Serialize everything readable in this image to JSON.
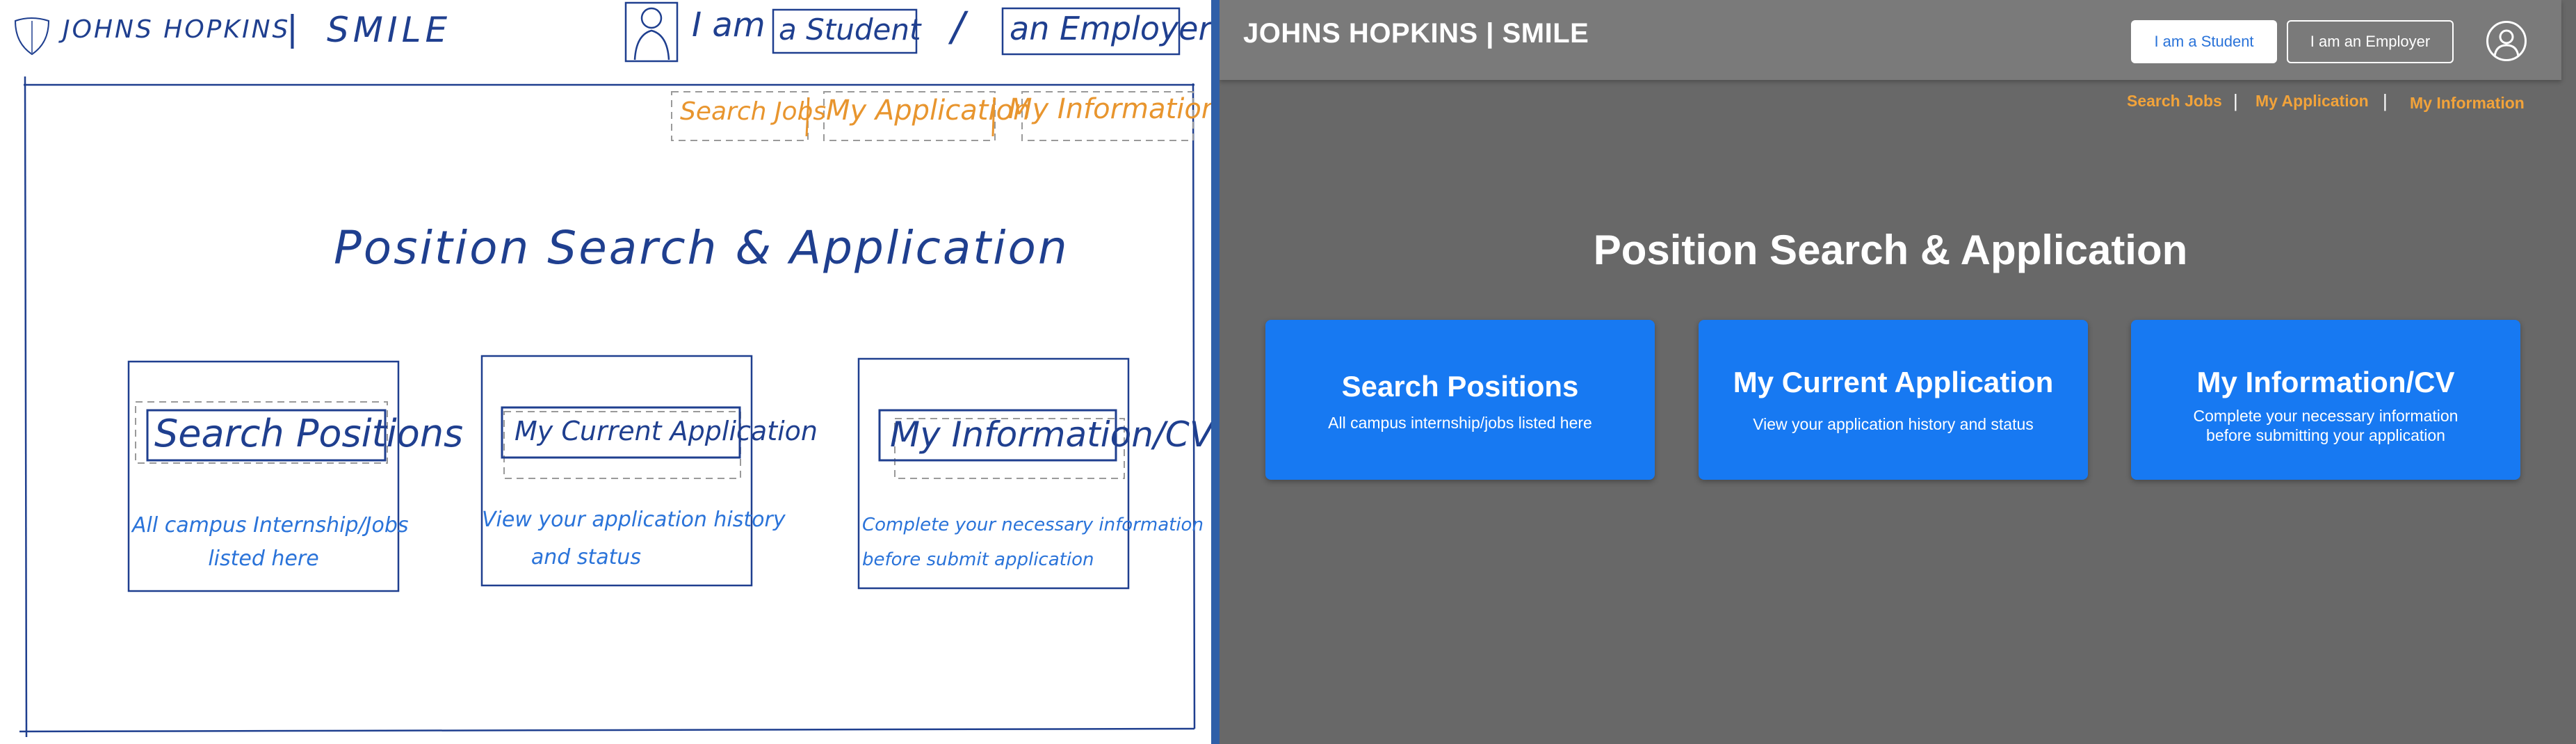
{
  "sketch": {
    "brand": "JOHNS HOPKINS",
    "brand_sep": "|",
    "brand_smile": "SMILE",
    "i_am": "I am",
    "student": "a Student",
    "slash": "/",
    "employer": "an Employer",
    "nav": [
      "Search Jobs",
      "My Application",
      "My Information"
    ],
    "title": "Position Search & Application",
    "cards": [
      {
        "title": "Search Positions",
        "desc_lines": [
          "All campus Internship/Jobs",
          "listed here"
        ]
      },
      {
        "title": "My Current Application",
        "desc_lines": [
          "View your application history",
          "and status"
        ]
      },
      {
        "title": "My Information/CV",
        "desc_lines": [
          "Complete your necessary information",
          "before submit application"
        ]
      }
    ]
  },
  "mock": {
    "brand": "JOHNS HOPKINS | SMILE",
    "student_button": "I am a Student",
    "employer_button": "I am an Employer",
    "nav": [
      "Search Jobs",
      "My Application",
      "My Information"
    ],
    "nav_separator": "|",
    "title": "Position Search & Application",
    "cards": [
      {
        "title": "Search Positions",
        "desc_lines": [
          "All campus internship/jobs listed here"
        ]
      },
      {
        "title": "My Current Application",
        "desc_lines": [
          "View your application history and status"
        ]
      },
      {
        "title": "My Information/CV",
        "desc_lines": [
          "Complete your necessary information",
          "before submitting your application"
        ]
      }
    ]
  },
  "colors": {
    "sketch_ink": "#1f3f8f",
    "sketch_orange": "#e8952e",
    "mock_background": "#686868",
    "mock_header": "#7a7a7a",
    "card_blue": "#1779f2",
    "nav_orange": "#f2a33a"
  },
  "icons": {
    "sketch_logo": "shield-icon",
    "sketch_person": "person-icon",
    "mock_avatar": "user-avatar-icon"
  }
}
